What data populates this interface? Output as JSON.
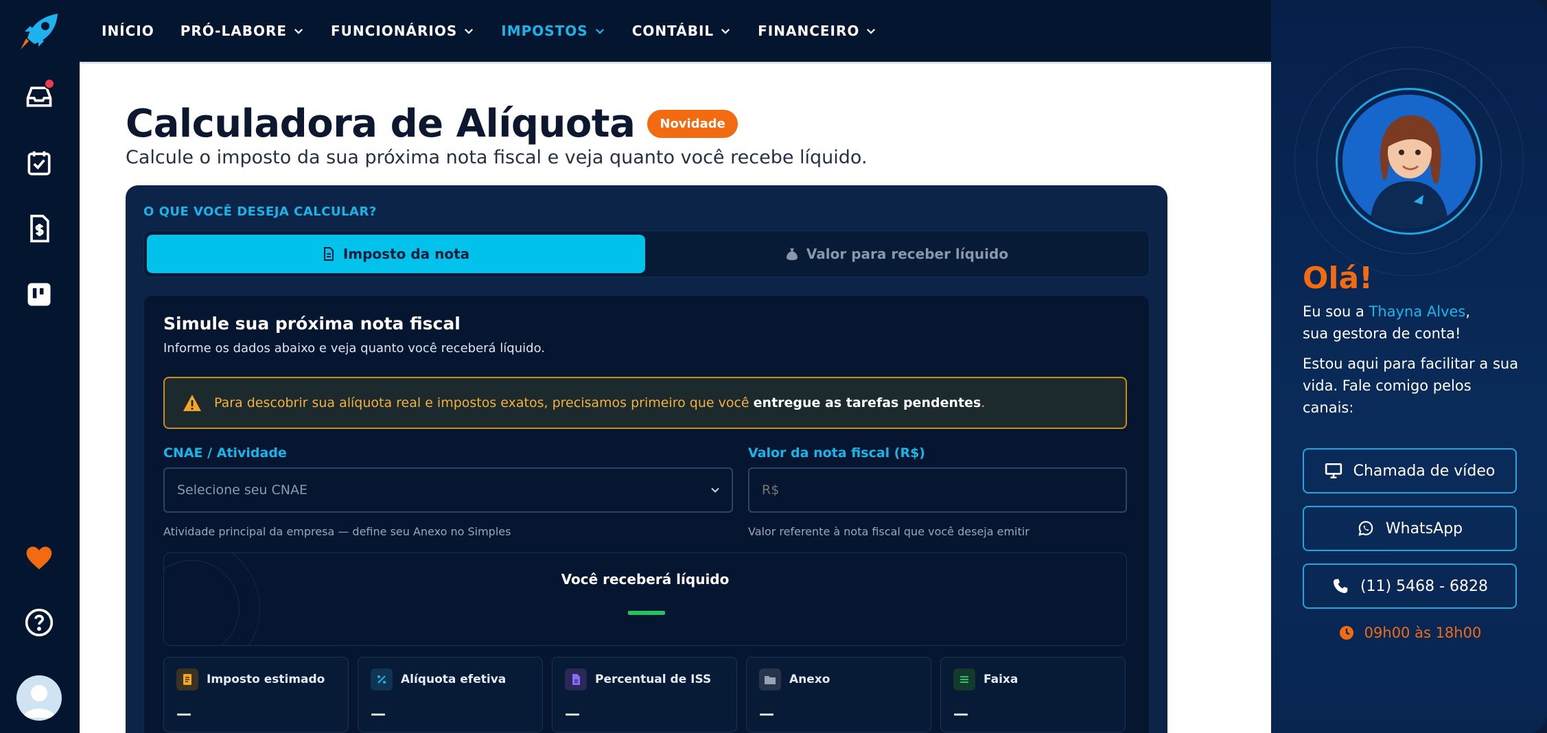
{
  "nav": {
    "items": [
      {
        "label": "INÍCIO",
        "dropdown": false,
        "active": false
      },
      {
        "label": "PRÓ-LABORE",
        "dropdown": true,
        "active": false
      },
      {
        "label": "FUNCIONÁRIOS",
        "dropdown": true,
        "active": false
      },
      {
        "label": "IMPOSTOS",
        "dropdown": true,
        "active": true
      },
      {
        "label": "CONTÁBIL",
        "dropdown": true,
        "active": false
      },
      {
        "label": "FINANCEIRO",
        "dropdown": true,
        "active": false
      }
    ]
  },
  "sidebar": {
    "icons": [
      "rocket-logo",
      "inbox-icon",
      "calendar-check-icon",
      "invoice-dollar-icon",
      "kanban-board-icon",
      "heart-icon",
      "help-circle-icon",
      "user-avatar"
    ],
    "inbox_has_notification": true
  },
  "page": {
    "title": "Calculadora de Alíquota",
    "badge": "Novidade",
    "subtitle": "Calcule o imposto da sua próxima nota fiscal e veja quanto você recebe líquido."
  },
  "calculator": {
    "question": "O QUE VOCÊ DESEJA CALCULAR?",
    "tabs": [
      {
        "label": "Imposto da nota",
        "icon": "document-icon",
        "active": true
      },
      {
        "label": "Valor para receber líquido",
        "icon": "money-bag-icon",
        "active": false
      }
    ],
    "form": {
      "title": "Simule sua próxima nota fiscal",
      "subtitle": "Informe os dados abaixo e veja quanto você receberá líquido.",
      "warning_text": "Para descobrir sua alíquota real e impostos exatos, precisamos primeiro que você ",
      "warning_bold": "entregue as tarefas pendentes",
      "warning_end": ".",
      "cnae_label": "CNAE / Atividade",
      "cnae_placeholder": "Selecione seu CNAE",
      "cnae_help": "Atividade principal da empresa — define seu Anexo no Simples",
      "value_label": "Valor da nota fiscal (R$)",
      "value_placeholder": "R$",
      "value_help": "Valor referente à nota fiscal que você deseja emitir"
    },
    "result_title": "Você receberá líquido",
    "metrics": [
      {
        "label": "Imposto estimado",
        "value": "—",
        "icon": "receipt-icon",
        "color": "#f5a524"
      },
      {
        "label": "Alíquota efetiva",
        "value": "—",
        "icon": "percent-icon",
        "color": "#17b6ea"
      },
      {
        "label": "Percentual de ISS",
        "value": "—",
        "icon": "file-icon",
        "color": "#8b6cf6"
      },
      {
        "label": "Anexo",
        "value": "—",
        "icon": "folder-icon",
        "color": "#94a3b8"
      },
      {
        "label": "Faixa",
        "value": "—",
        "icon": "list-icon",
        "color": "#22c55e"
      }
    ]
  },
  "manager": {
    "greeting": "Olá!",
    "intro_prefix": "Eu sou a ",
    "name": "Thayna Alves",
    "intro_suffix": ",",
    "role": "sua gestora de conta!",
    "message": "Estou aqui para facilitar a sua vida. Fale comigo pelos canais:",
    "buttons": [
      {
        "label": "Chamada de vídeo",
        "icon": "monitor-icon"
      },
      {
        "label": "WhatsApp",
        "icon": "whatsapp-icon"
      },
      {
        "label": "(11) 5468 - 6828",
        "icon": "phone-icon"
      }
    ],
    "hours": "09h00 às 18h00"
  },
  "colors": {
    "accent": "#17b6ea",
    "orange": "#f26b10",
    "navy": "#04152f",
    "tab_active": "#00c2ea"
  }
}
